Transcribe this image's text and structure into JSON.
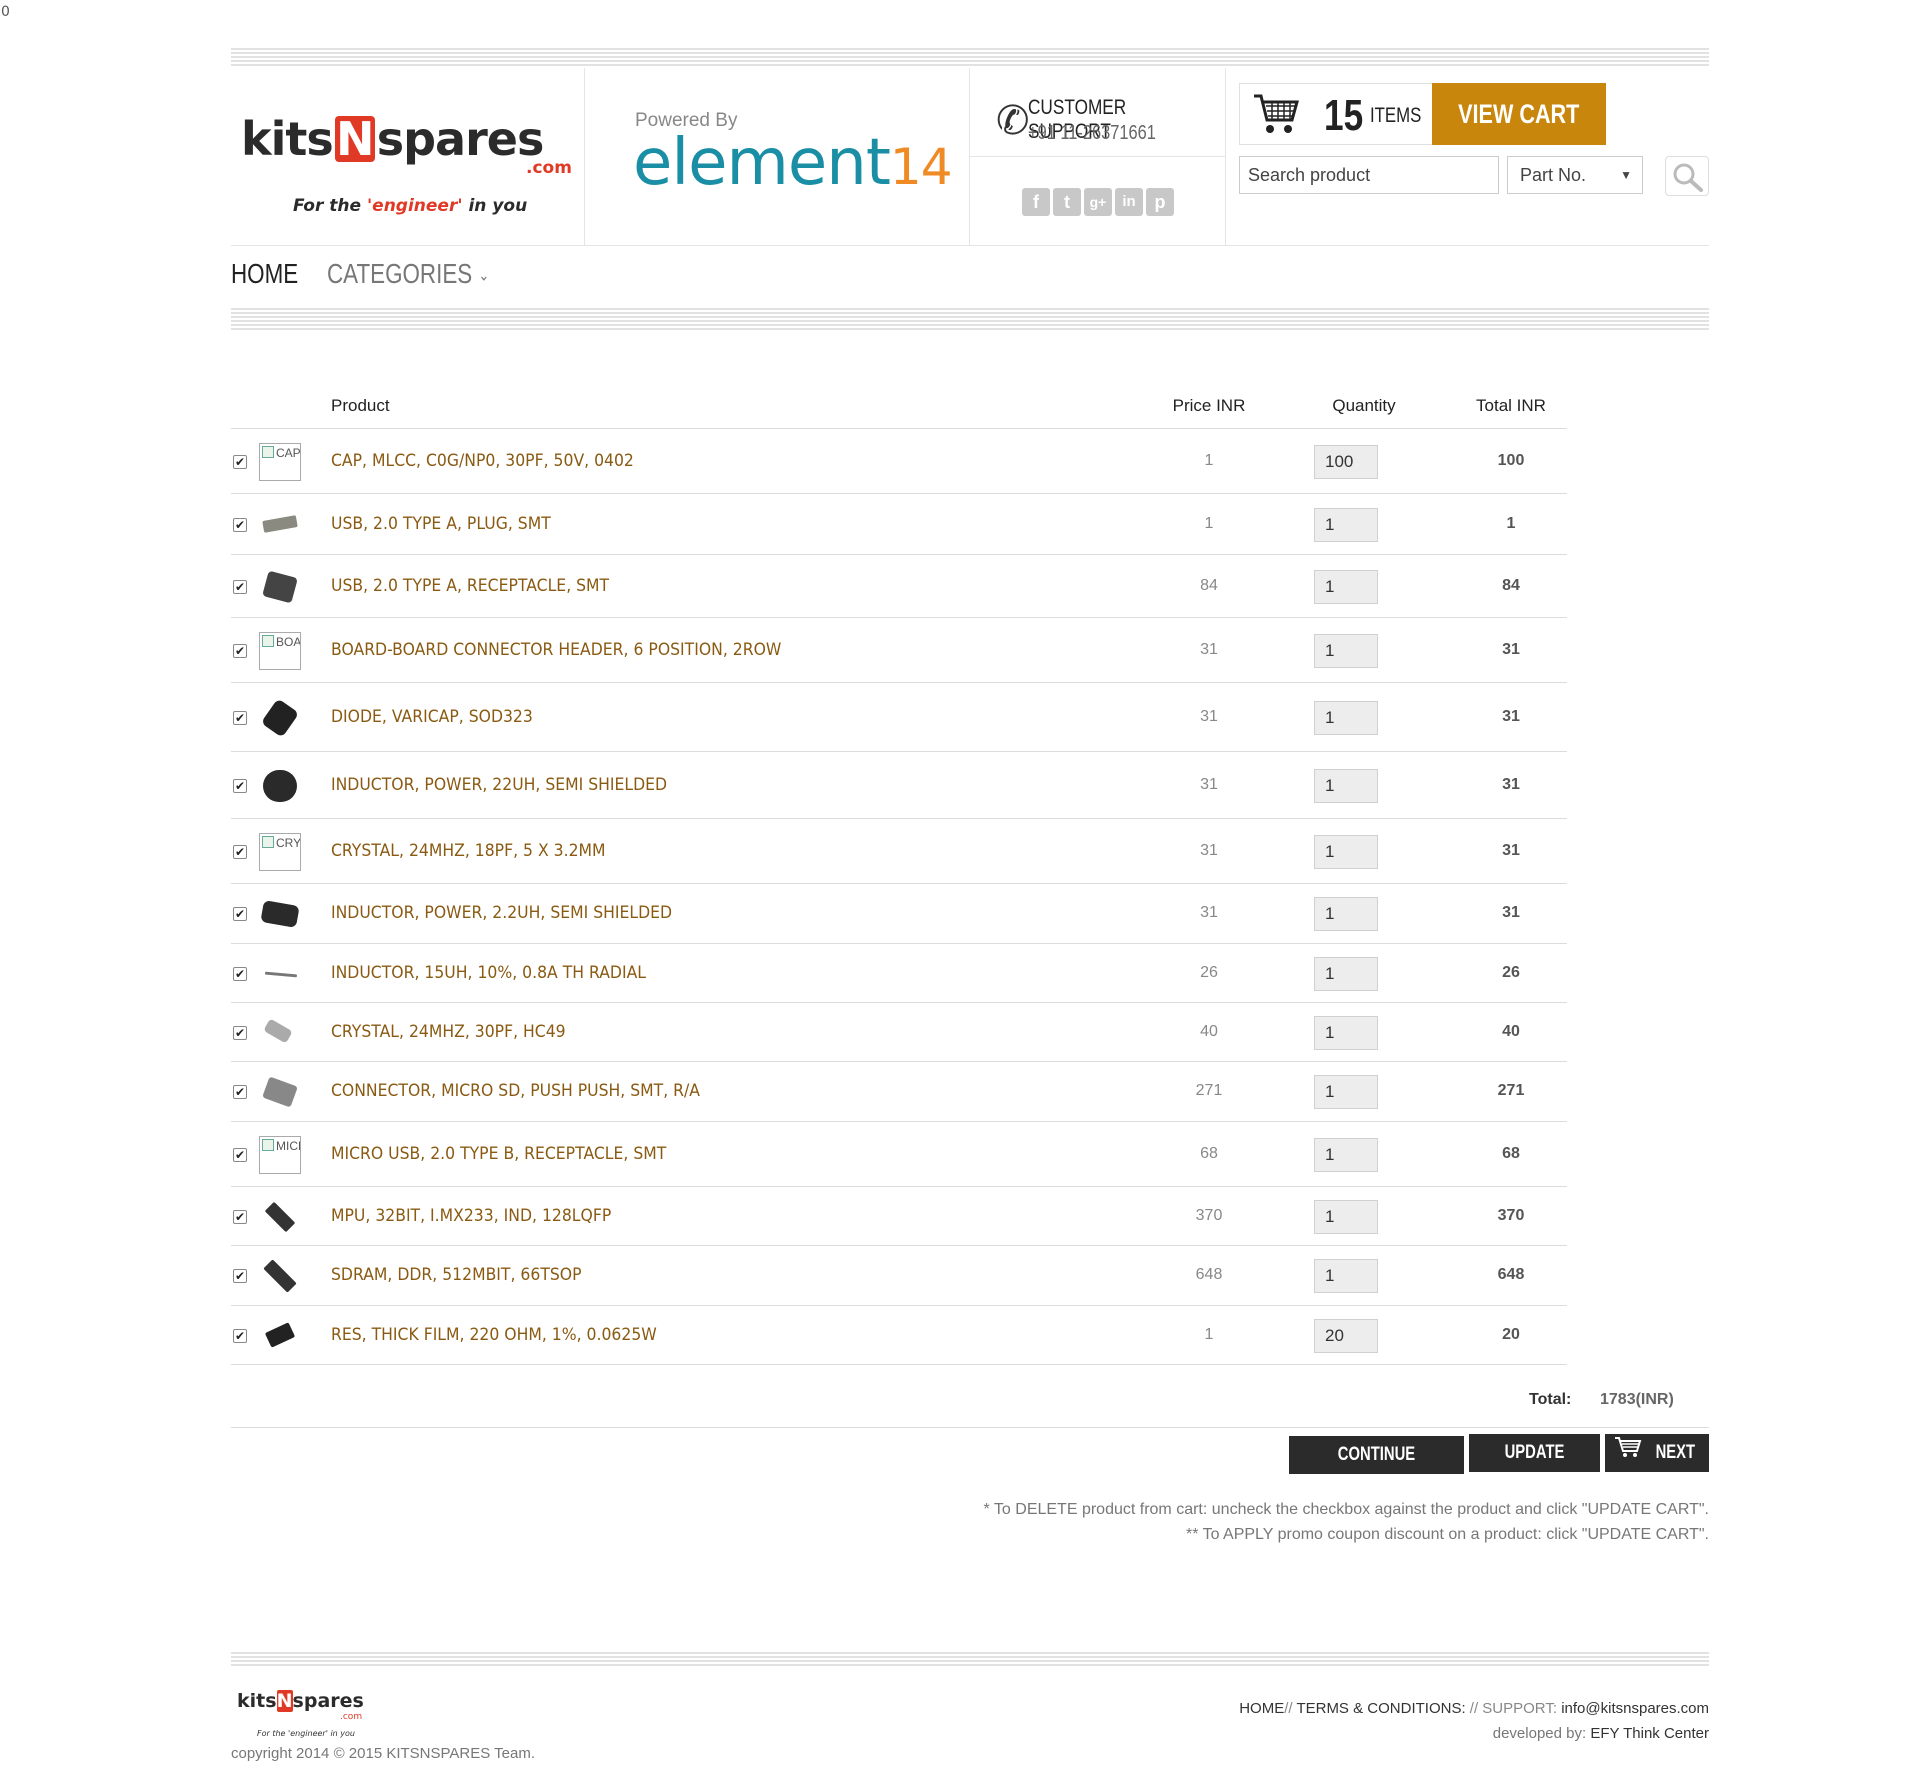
{
  "corner_text": "0",
  "header": {
    "logo": {
      "part1": "kits",
      "n": "N",
      "part2": "spares",
      "com": ".com",
      "tagline_pre": "For the ",
      "tagline_highlight": "'engineer'",
      "tagline_post": " in you"
    },
    "powered_by": "Powered By",
    "partner_logo": {
      "text": "element",
      "number": "14"
    },
    "support": {
      "title": "CUSTOMER SUPPORT",
      "phone": "+91 11-26371661"
    },
    "social": [
      "f",
      "t",
      "g+",
      "in",
      "p"
    ],
    "cart": {
      "count": "15",
      "items_label": "ITEMS",
      "view_cart_label": "VIEW CART"
    },
    "search": {
      "placeholder": "Search product",
      "filter_selected": "Part No."
    }
  },
  "nav": {
    "home": "HOME",
    "categories": "CATEGORIES"
  },
  "table": {
    "headers": {
      "product": "Product",
      "price": "Price INR",
      "quantity": "Quantity",
      "total": "Total INR"
    },
    "rows": [
      {
        "name": "CAP, MLCC, C0G/NP0, 30PF, 50V, 0402",
        "price": "1",
        "qty": "100",
        "total": "100",
        "thumb_alt": "CAP, MLCC"
      },
      {
        "name": "USB, 2.0 TYPE A, PLUG, SMT",
        "price": "1",
        "qty": "1",
        "total": "1",
        "thumb_alt": ""
      },
      {
        "name": "USB, 2.0 TYPE A, RECEPTACLE, SMT",
        "price": "84",
        "qty": "1",
        "total": "84",
        "thumb_alt": ""
      },
      {
        "name": "BOARD-BOARD CONNECTOR HEADER, 6 POSITION, 2ROW",
        "price": "31",
        "qty": "1",
        "total": "31",
        "thumb_alt": "BOARD-BOARD"
      },
      {
        "name": "DIODE, VARICAP, SOD323",
        "price": "31",
        "qty": "1",
        "total": "31",
        "thumb_alt": ""
      },
      {
        "name": "INDUCTOR, POWER, 22UH, SEMI SHIELDED",
        "price": "31",
        "qty": "1",
        "total": "31",
        "thumb_alt": ""
      },
      {
        "name": "CRYSTAL, 24MHZ, 18PF, 5 X 3.2MM",
        "price": "31",
        "qty": "1",
        "total": "31",
        "thumb_alt": "CRYSTAL"
      },
      {
        "name": "INDUCTOR, POWER, 2.2UH, SEMI SHIELDED",
        "price": "31",
        "qty": "1",
        "total": "31",
        "thumb_alt": ""
      },
      {
        "name": "INDUCTOR, 15UH, 10%, 0.8A TH RADIAL",
        "price": "26",
        "qty": "1",
        "total": "26",
        "thumb_alt": ""
      },
      {
        "name": "CRYSTAL, 24MHZ, 30PF, HC49",
        "price": "40",
        "qty": "1",
        "total": "40",
        "thumb_alt": ""
      },
      {
        "name": "CONNECTOR, MICRO SD, PUSH PUSH, SMT, R/A",
        "price": "271",
        "qty": "1",
        "total": "271",
        "thumb_alt": ""
      },
      {
        "name": "MICRO USB, 2.0 TYPE B, RECEPTACLE, SMT",
        "price": "68",
        "qty": "1",
        "total": "68",
        "thumb_alt": "MICRO USB"
      },
      {
        "name": "MPU, 32BIT, I.MX233, IND, 128LQFP",
        "price": "370",
        "qty": "1",
        "total": "370",
        "thumb_alt": ""
      },
      {
        "name": "SDRAM, DDR, 512MBIT, 66TSOP",
        "price": "648",
        "qty": "1",
        "total": "648",
        "thumb_alt": ""
      },
      {
        "name": "RES, THICK FILM, 220 OHM, 1%, 0.0625W",
        "price": "1",
        "qty": "20",
        "total": "20",
        "thumb_alt": ""
      }
    ],
    "total_label": "Total:",
    "total_value": "1783(INR)"
  },
  "buttons": {
    "continue": "CONTINUE SHOPPING",
    "update": "UPDATE CART",
    "next": "NEXT"
  },
  "notes": [
    "* To DELETE product from cart: uncheck the checkbox against the product and click \"UPDATE CART\".",
    "** To APPLY promo coupon discount on a product: click \"UPDATE CART\"."
  ],
  "footer": {
    "logo": {
      "part1": "kits",
      "n": "N",
      "part2": "spares",
      "com": ".com",
      "tagline": "For the 'engineer' in you"
    },
    "copyright": "copyright 2014 © 2015 KITSNSPARES Team.",
    "links": {
      "home": "HOME",
      "terms": "TERMS & CONDITIONS:",
      "support_label": "SUPPORT:",
      "email": "info@kitsnspares.com"
    },
    "developed_label": "developed by:",
    "developer": "EFY Think Center"
  },
  "colors": {
    "accent": "#c8860d",
    "product_link": "#8a5a12",
    "brand_red": "#e03a26",
    "element14_blue": "#1a8ea5",
    "element14_orange": "#f08a24"
  }
}
